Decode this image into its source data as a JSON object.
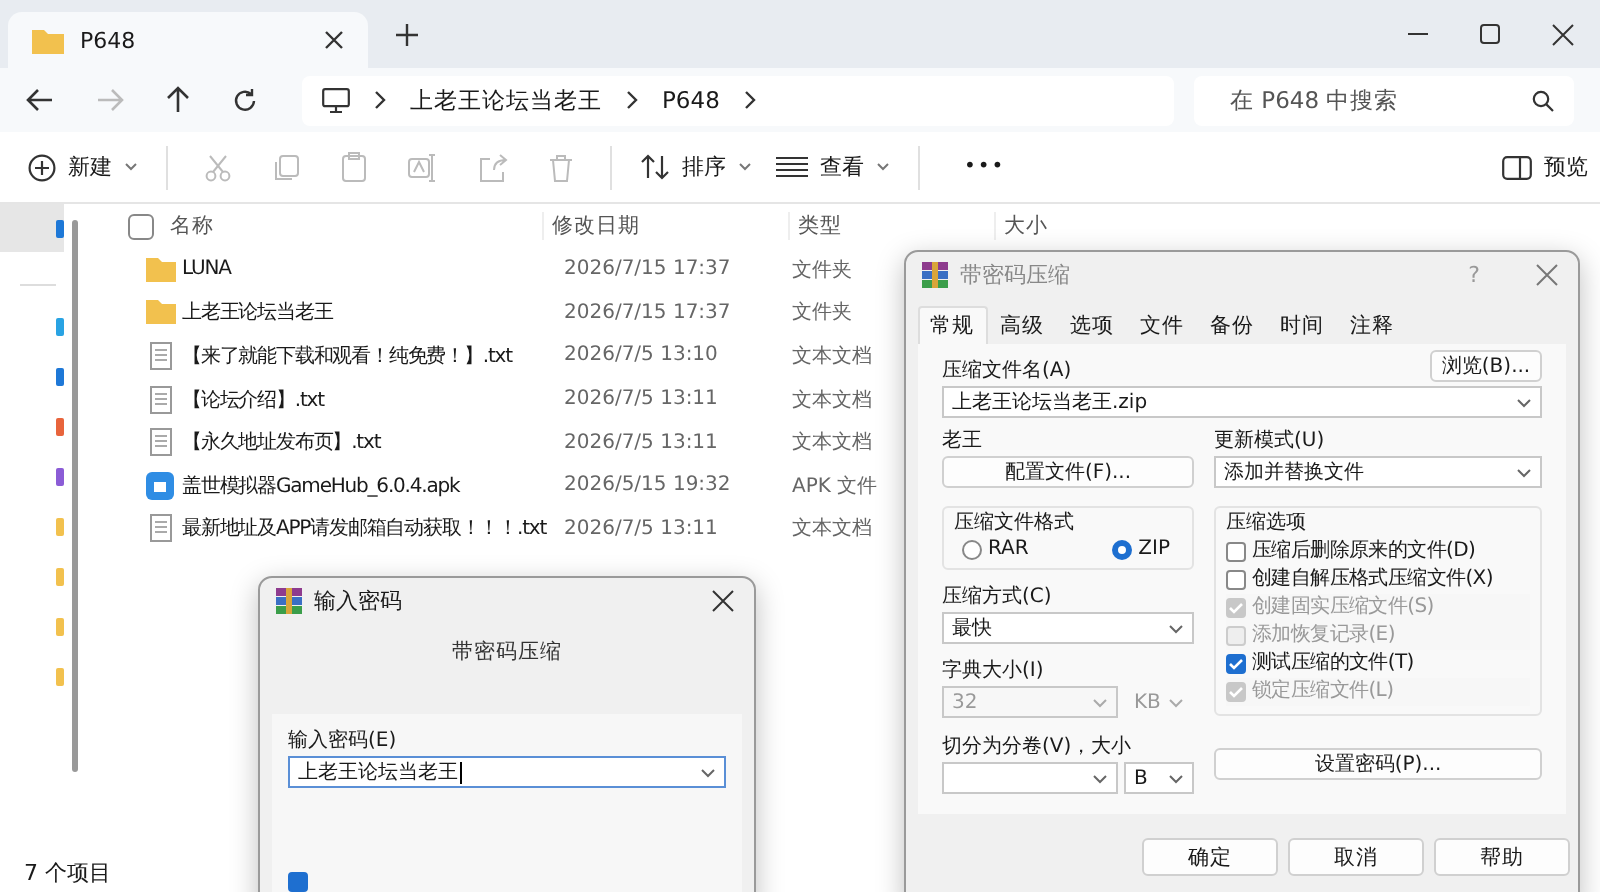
{
  "explorer": {
    "tab": {
      "title": "P648"
    },
    "breadcrumb": [
      "上老王论坛当老王",
      "P648"
    ],
    "search": {
      "placeholder": "在 P648 中搜索"
    },
    "toolbar": {
      "new": "新建",
      "sort": "排序",
      "view": "查看",
      "more": "•••",
      "preview": "预览"
    },
    "select_all": {
      "checked": false
    },
    "columns": [
      "名称",
      "修改日期",
      "类型",
      "大小"
    ],
    "rows": [
      {
        "kind": "folder",
        "name": "LUNA",
        "date": "2026/7/15 17:37",
        "type": "文件夹"
      },
      {
        "kind": "folder",
        "name": "上老王论坛当老王",
        "date": "2026/7/15 17:37",
        "type": "文件夹"
      },
      {
        "kind": "text",
        "name": "【来了就能下载和观看！纯免费！】.txt",
        "date": "2026/7/5 13:10",
        "type": "文本文档"
      },
      {
        "kind": "text",
        "name": "【论坛介绍】.txt",
        "date": "2026/7/5 13:11",
        "type": "文本文档"
      },
      {
        "kind": "text",
        "name": "【永久地址发布页】.txt",
        "date": "2026/7/5 13:11",
        "type": "文本文档"
      },
      {
        "kind": "apk",
        "name": "盖世模拟器GameHub_6.0.4.apk",
        "date": "2026/5/15 19:32",
        "type": "APK 文件"
      },
      {
        "kind": "text",
        "name": "最新地址及APP请发邮箱自动获取！！！.txt",
        "date": "2026/7/5 13:11",
        "type": "文本文档"
      }
    ],
    "status_bar": "7 个项目"
  },
  "compress_dialog": {
    "title": "带密码压缩",
    "help": "?",
    "tabs": [
      {
        "label": "常规",
        "selected": true
      },
      {
        "label": "高级",
        "selected": false
      },
      {
        "label": "选项",
        "selected": false
      },
      {
        "label": "文件",
        "selected": false
      },
      {
        "label": "备份",
        "selected": false
      },
      {
        "label": "时间",
        "selected": false
      },
      {
        "label": "注释",
        "selected": false
      }
    ],
    "archive_name_label": "压缩文件名(A)",
    "browse_button": "浏览(B)...",
    "archive_name": "上老王论坛当老王.zip",
    "profile_label": "老王",
    "profile_button": "配置文件(F)...",
    "update_mode_label": "更新模式(U)",
    "update_mode": "添加并替换文件",
    "format_label": "压缩文件格式",
    "formats": [
      {
        "label": "RAR",
        "selected": false
      },
      {
        "label": "ZIP",
        "selected": true
      }
    ],
    "options_label": "压缩选项",
    "options": [
      {
        "label": "压缩后删除原来的文件(D)",
        "checked": false,
        "disabled": false
      },
      {
        "label": "创建自解压格式压缩文件(X)",
        "checked": false,
        "disabled": false
      },
      {
        "label": "创建固实压缩文件(S)",
        "checked": true,
        "disabled": true
      },
      {
        "label": "添加恢复记录(E)",
        "checked": false,
        "disabled": true
      },
      {
        "label": "测试压缩的文件(T)",
        "checked": true,
        "disabled": false
      },
      {
        "label": "锁定压缩文件(L)",
        "checked": true,
        "disabled": true
      }
    ],
    "method_label": "压缩方式(C)",
    "method": "最快",
    "dict_label": "字典大小(I)",
    "dict_size": "32",
    "dict_unit": "KB",
    "dict_disabled": true,
    "split_label": "切分为分卷(V)，大小",
    "split_unit": "B",
    "password_button": "设置密码(P)...",
    "buttons": [
      "确定",
      "取消",
      "帮助"
    ]
  },
  "password_dialog": {
    "title": "输入密码",
    "heading": "带密码压缩",
    "label": "输入密码(E)",
    "value": "上老王论坛当老王",
    "show_password": {
      "checked": true
    }
  }
}
